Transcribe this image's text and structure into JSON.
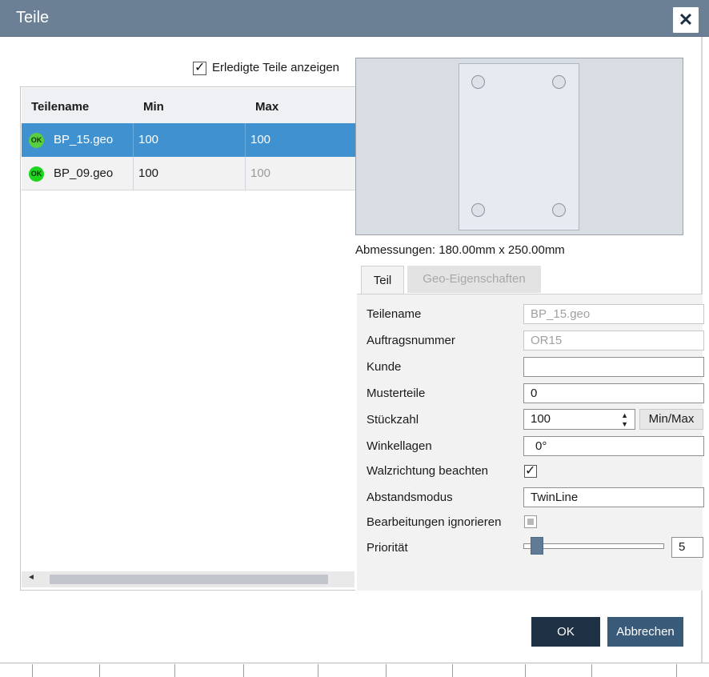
{
  "window": {
    "title": "Teile",
    "close_glyph": "✕"
  },
  "show_done": {
    "label": "Erledigte Teile anzeigen",
    "checked": true,
    "check_glyph": "✓"
  },
  "grid": {
    "columns": [
      "Teilename",
      "Min",
      "Max"
    ],
    "rows": [
      {
        "status": "OK",
        "name": "BP_15.geo",
        "min": "100",
        "max": "100",
        "selected": true
      },
      {
        "status": "OK",
        "name": "BP_09.geo",
        "min": "100",
        "max": "100",
        "selected": false
      }
    ],
    "scroll_left_glyph": "◄"
  },
  "preview": {
    "dimensions": "Abmessungen: 180.00mm x 250.00mm"
  },
  "tabs": [
    {
      "label": "Teil",
      "active": true
    },
    {
      "label": "Geo-Eigenschaften",
      "active": false
    }
  ],
  "properties": {
    "teilename": {
      "label": "Teilename",
      "value": "BP_15.geo"
    },
    "auftragsnummer": {
      "label": "Auftragsnummer",
      "value": "OR15"
    },
    "kunde": {
      "label": "Kunde",
      "value": ""
    },
    "musterteile": {
      "label": "Musterteile",
      "value": "0"
    },
    "stueckzahl": {
      "label": "Stückzahl",
      "value": "100",
      "minmax_label": "Min/Max",
      "spin_up": "▲",
      "spin_down": "▼"
    },
    "winkellagen": {
      "label": "Winkellagen",
      "value": "0°"
    },
    "walzrichtung": {
      "label": "Walzrichtung beachten",
      "checked": true,
      "check_glyph": "✓"
    },
    "abstandsmodus": {
      "label": "Abstandsmodus",
      "value": "TwinLine"
    },
    "bearbeitungen": {
      "label": "Bearbeitungen ignorieren",
      "checked": false
    },
    "prioritaet": {
      "label": "Priorität",
      "value": "5",
      "slider_fraction": 0.05
    }
  },
  "buttons": {
    "ok": "OK",
    "cancel": "Abbrechen"
  },
  "colors": {
    "titlebar": "#6b7f95",
    "selection": "#3f91d0",
    "ok_button": "#1f3144",
    "cancel_button": "#3a5a79",
    "status_ok": "#1bd41b"
  }
}
